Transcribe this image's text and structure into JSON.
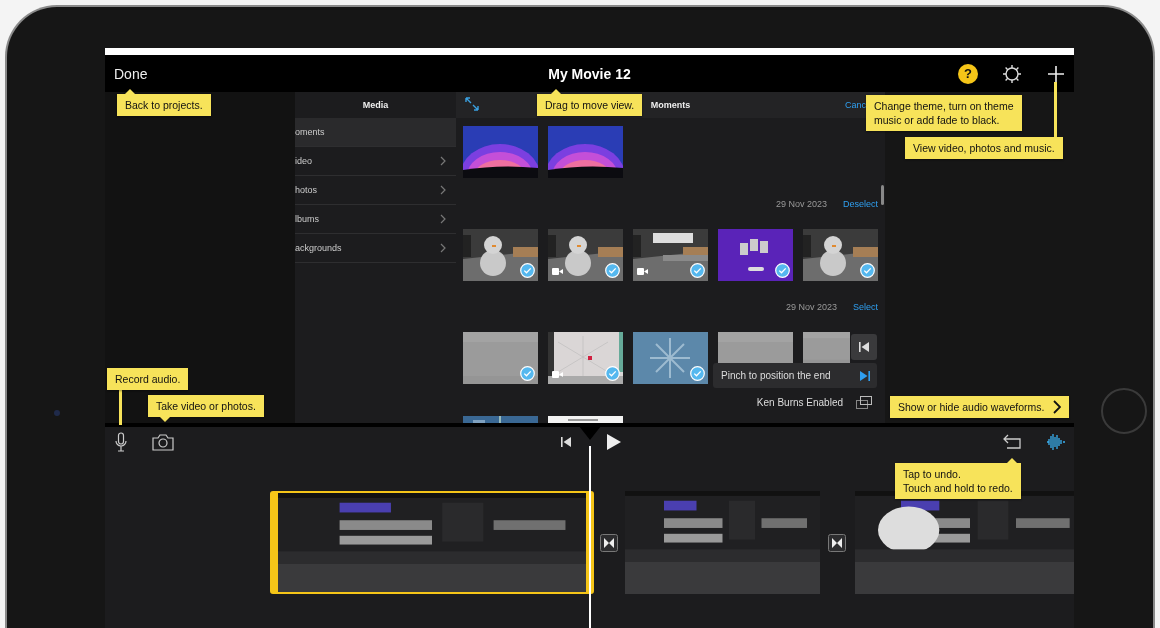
{
  "nav": {
    "done": "Done",
    "title": "My Movie 12",
    "help": "?"
  },
  "media_list": {
    "title": "Media",
    "items": [
      {
        "label": "oments",
        "selected": true,
        "chevron": false
      },
      {
        "label": "ideo",
        "selected": false,
        "chevron": true
      },
      {
        "label": "hotos",
        "selected": false,
        "chevron": true
      },
      {
        "label": "lbums",
        "selected": false,
        "chevron": true
      },
      {
        "label": "ackgrounds",
        "selected": false,
        "chevron": true
      }
    ]
  },
  "grid": {
    "title": "Moments",
    "cancel": "Canc",
    "sections": [
      {
        "items": [
          {
            "kind": "picture",
            "checked": false,
            "video": false
          },
          {
            "kind": "picture",
            "checked": false,
            "video": false
          }
        ]
      },
      {
        "date": "29 Nov 2023",
        "action": "Deselect",
        "items": [
          {
            "kind": "picture",
            "checked": true,
            "video": false
          },
          {
            "kind": "picture",
            "checked": true,
            "video": true
          },
          {
            "kind": "picture",
            "checked": true,
            "video": true
          },
          {
            "kind": "picture",
            "checked": true,
            "video": false
          },
          {
            "kind": "picture",
            "checked": true,
            "video": false
          }
        ]
      },
      {
        "date": "29 Nov 2023",
        "action": "Select",
        "items": [
          {
            "kind": "picture",
            "checked": true,
            "video": false
          },
          {
            "kind": "picture",
            "checked": true,
            "video": true
          },
          {
            "kind": "picture",
            "checked": true,
            "video": false
          },
          {
            "kind": "picture"
          },
          {
            "kind": "picture"
          }
        ]
      },
      {
        "items": [
          {
            "kind": "picture"
          },
          {
            "kind": "picture"
          }
        ]
      }
    ]
  },
  "trim_hint": {
    "text": "Pinch to position the end"
  },
  "ken_burns": {
    "label": "Ken Burns Enabled"
  },
  "timeline": {
    "clips": [
      {
        "kind": "picture",
        "selected": true
      },
      {
        "kind": "picture",
        "selected": false
      },
      {
        "kind": "picture",
        "selected": false
      }
    ]
  },
  "tooltips": [
    {
      "text": "Back to projects.",
      "chevron": false
    },
    {
      "text": "Drag to move view.",
      "chevron": false
    },
    {
      "text": "Change theme, turn on theme\nmusic or add fade to black.",
      "chevron": false
    },
    {
      "text": "View video, photos and music.",
      "chevron": false
    },
    {
      "text": "Record audio.",
      "chevron": false
    },
    {
      "text": "Take video or photos.",
      "chevron": false
    },
    {
      "text": "Show or hide audio waveforms.",
      "chevron": true
    },
    {
      "text": "Tap to undo.\nTouch and hold to redo.",
      "chevron": false
    }
  ]
}
